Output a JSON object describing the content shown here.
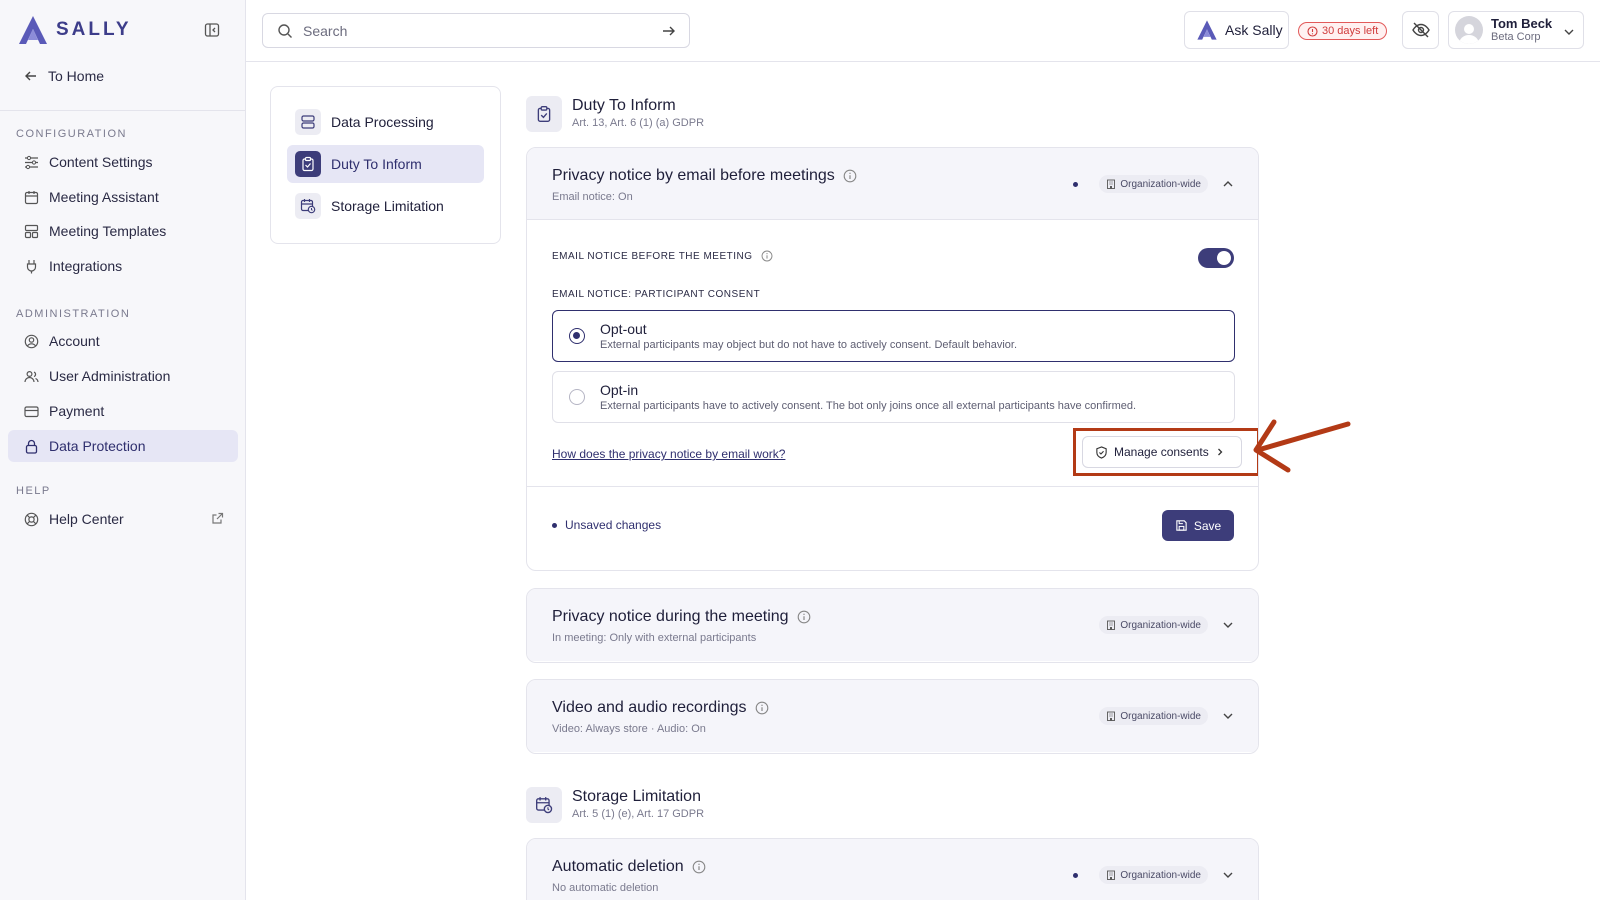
{
  "app": {
    "brand": "SALLY"
  },
  "sidebar": {
    "back_label": "To Home",
    "sections": [
      {
        "label": "CONFIGURATION"
      },
      {
        "label": "ADMINISTRATION"
      },
      {
        "label": "HELP"
      }
    ],
    "items": [
      {
        "label": "Content Settings",
        "icon": "sliders-icon"
      },
      {
        "label": "Meeting Assistant",
        "icon": "calendar-icon"
      },
      {
        "label": "Meeting Templates",
        "icon": "template-icon"
      },
      {
        "label": "Integrations",
        "icon": "plug-icon"
      },
      {
        "label": "Account",
        "icon": "account-icon"
      },
      {
        "label": "User Administration",
        "icon": "users-icon"
      },
      {
        "label": "Payment",
        "icon": "card-icon"
      },
      {
        "label": "Data Protection",
        "icon": "lock-icon",
        "active": true
      },
      {
        "label": "Help Center",
        "icon": "lifebuoy-icon"
      }
    ]
  },
  "topbar": {
    "search_placeholder": "Search",
    "ask_label": "Ask Sally",
    "trial_label": "30 days left",
    "user_name": "Tom Beck",
    "user_org": "Beta Corp"
  },
  "subnav": {
    "items": [
      {
        "label": "Data Processing"
      },
      {
        "label": "Duty To Inform",
        "active": true
      },
      {
        "label": "Storage Limitation"
      }
    ]
  },
  "duty": {
    "title": "Duty To Inform",
    "subtitle": "Art. 13, Art. 6 (1) (a) GDPR"
  },
  "email_card": {
    "title": "Privacy notice by email before meetings",
    "sub": "Email notice: On",
    "badge": "Organization-wide",
    "toggle_label": "EMAIL NOTICE BEFORE THE MEETING",
    "toggle_on": true,
    "consent_label": "EMAIL NOTICE: PARTICIPANT CONSENT",
    "options": [
      {
        "title": "Opt-out",
        "desc": "External participants may object but do not have to actively consent. Default behavior.",
        "selected": true
      },
      {
        "title": "Opt-in",
        "desc": "External participants have to actively consent. The bot only joins once all external participants have confirmed.",
        "selected": false
      }
    ],
    "how_link": "How does the privacy notice by email work?",
    "manage_label": "Manage consents",
    "unsaved_label": "Unsaved changes",
    "save_label": "Save"
  },
  "meeting_card": {
    "title": "Privacy notice during the meeting",
    "sub": "In meeting: Only with external participants",
    "badge": "Organization-wide"
  },
  "recording_card": {
    "title": "Video and audio recordings",
    "sub": "Video: Always store · Audio: On",
    "badge": "Organization-wide"
  },
  "storage": {
    "title": "Storage Limitation",
    "subtitle": "Art. 5 (1) (e), Art. 17 GDPR"
  },
  "deletion_card": {
    "title": "Automatic deletion",
    "sub": "No automatic deletion",
    "badge": "Organization-wide"
  },
  "colors": {
    "accent": "#3d3d7a",
    "annotation": "#b33a16",
    "trial": "#d03c3c"
  }
}
